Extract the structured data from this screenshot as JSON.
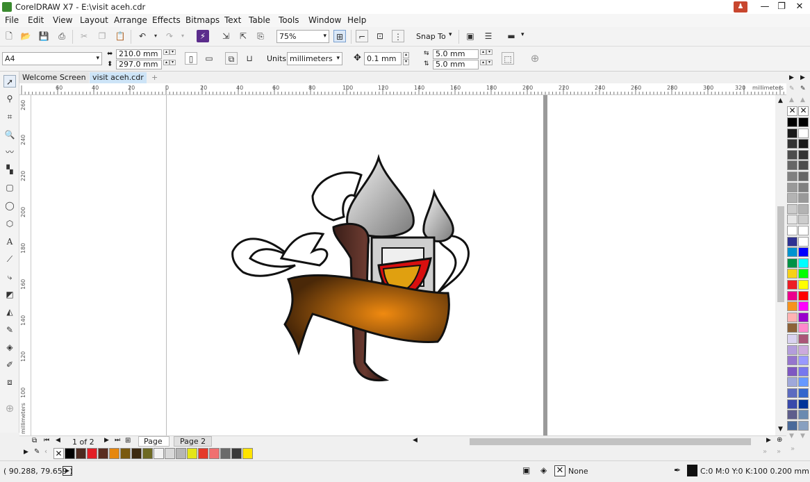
{
  "window": {
    "title": "CorelDRAW X7 - E:\\visit aceh.cdr"
  },
  "menu": [
    "File",
    "Edit",
    "View",
    "Layout",
    "Arrange",
    "Effects",
    "Bitmaps",
    "Text",
    "Table",
    "Tools",
    "Window",
    "Help"
  ],
  "std_toolbar": {
    "zoom_value": "75%",
    "snap_label": "Snap To"
  },
  "prop_bar": {
    "page_size": "A4",
    "width": "210.0 mm",
    "height": "297.0 mm",
    "units_label": "Units:",
    "units_value": "millimeters",
    "nudge": "0.1 mm",
    "dup_x": "5.0 mm",
    "dup_y": "5.0 mm"
  },
  "tabs": [
    "Welcome Screen",
    "visit aceh.cdr"
  ],
  "ruler": {
    "h_labels": [
      "60",
      "40",
      "20",
      "0",
      "20",
      "40",
      "60",
      "80",
      "100",
      "120",
      "140",
      "160",
      "180",
      "200",
      "220",
      "240",
      "260",
      "280",
      "300",
      "320"
    ],
    "h_unit": "millimeters",
    "v_labels": [
      "260",
      "240",
      "220",
      "200",
      "180",
      "160",
      "140",
      "120",
      "100"
    ],
    "v_unit": "millimeters"
  },
  "page_nav": {
    "counter": "1 of 2",
    "pages": [
      "Page 1",
      "Page 2"
    ]
  },
  "doc_palette": [
    "#000000",
    "#4d2a1f",
    "#e21f26",
    "#5a2d1f",
    "#e6870f",
    "#7a5a10",
    "#3d2a10",
    "#6e6a24",
    "#f2f2f2",
    "#d8d8d8",
    "#b5b5b5",
    "#e4e41a",
    "#e43a2a",
    "#f07070",
    "#6a6a6a",
    "#3a3a3a",
    "#ffe400"
  ],
  "palette_col1": [
    "#000000",
    "#1a1a1a",
    "#333333",
    "#4d4d4d",
    "#666666",
    "#808080",
    "#999999",
    "#b3b3b3",
    "#cccccc",
    "#e6e6e6",
    "#ffffff",
    "#2e3192",
    "#0093d0",
    "#009245",
    "#f7d117",
    "#ed1c24",
    "#ec008c",
    "#f7931e",
    "#ffb3b3",
    "#8c6239",
    "#d9d2f0",
    "#b39ddb",
    "#9575cd",
    "#7e57c2",
    "#9fa8da",
    "#5c6bc0",
    "#3949ab",
    "#5e5e8c",
    "#4a6a9a"
  ],
  "palette_col2": [
    "#000000",
    "#ffffff",
    "#1a1a1a",
    "#333333",
    "#4d4d4d",
    "#666666",
    "#808080",
    "#999999",
    "#b3b3b3",
    "#cccccc",
    "#ffffff",
    "#ffffff",
    "#0000ff",
    "#00ffff",
    "#00ff00",
    "#ffff00",
    "#ff0000",
    "#ff00ff",
    "#9900cc",
    "#ff88cc",
    "#aa5577",
    "#ccaadd",
    "#9999ff",
    "#7777ee",
    "#6699ff",
    "#3366cc",
    "#003399",
    "#6a8ab0",
    "#88a0c0"
  ],
  "status": {
    "coords": "( 90.288, 79.659 )",
    "fill_label": "None",
    "outline_label": "C:0 M:0 Y:0 K:100  0.200 mm"
  }
}
